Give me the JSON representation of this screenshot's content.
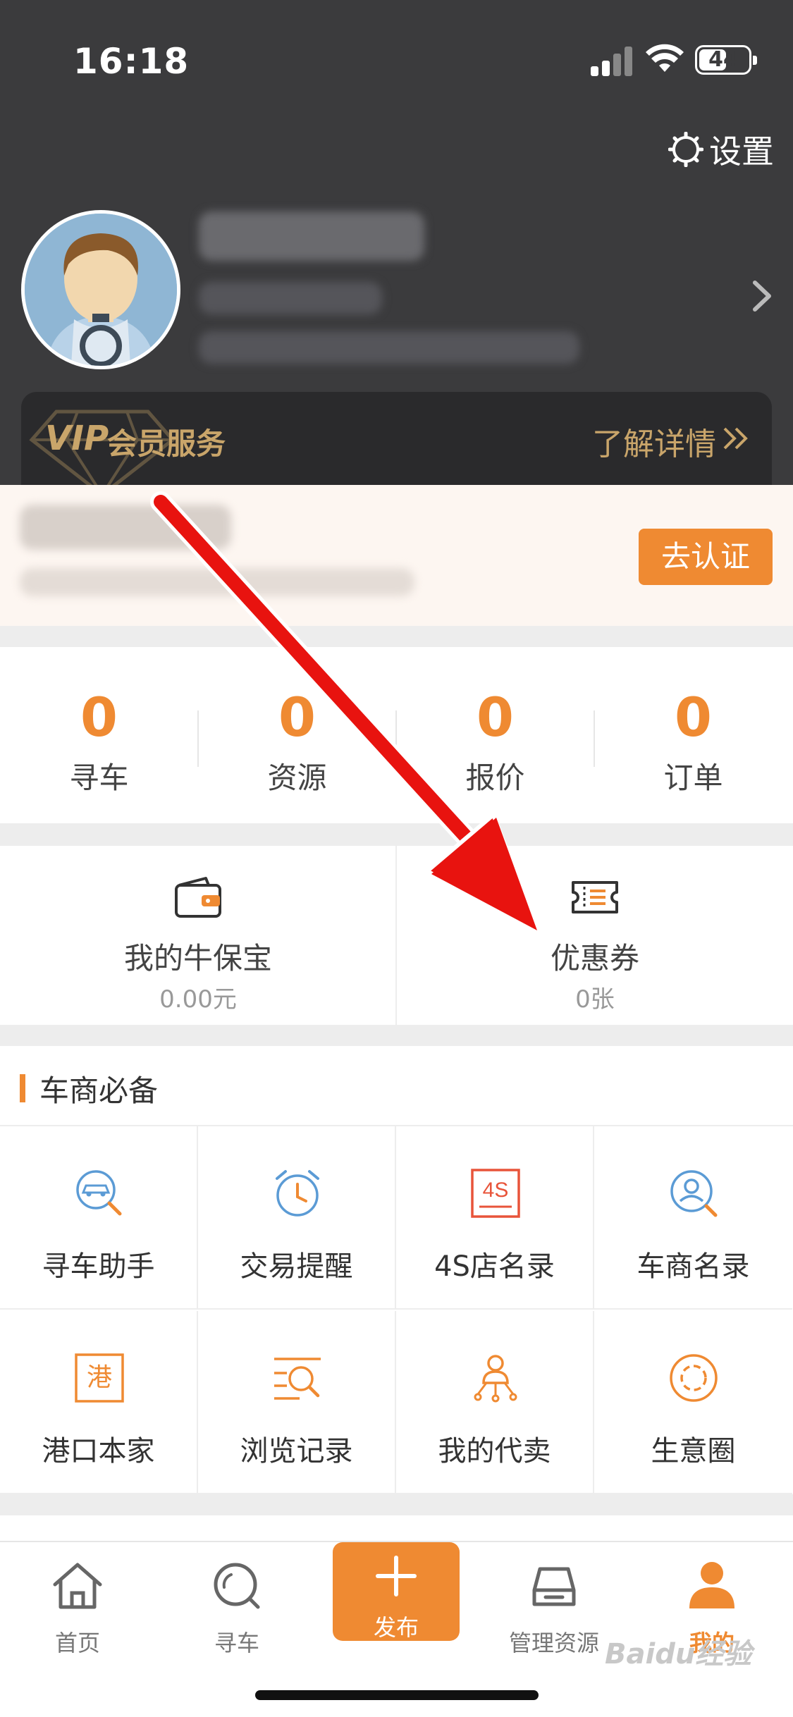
{
  "status_bar": {
    "time": "16:18",
    "battery": "44"
  },
  "header": {
    "settings_label": "设置",
    "vip": {
      "tag": "VIP",
      "title": "会员服务",
      "more": "了解详情"
    }
  },
  "certification": {
    "button": "去认证"
  },
  "stats": [
    {
      "value": "0",
      "label": "寻车"
    },
    {
      "value": "0",
      "label": "资源"
    },
    {
      "value": "0",
      "label": "报价"
    },
    {
      "value": "0",
      "label": "订单"
    }
  ],
  "wallet": {
    "left": {
      "label": "我的牛保宝",
      "sub": "0.00元",
      "icon": "wallet-icon"
    },
    "right": {
      "label": "优惠券",
      "sub": "0张",
      "icon": "coupon-icon"
    }
  },
  "tools": {
    "title": "车商必备",
    "items": [
      {
        "label": "寻车助手",
        "icon": "car-search-icon"
      },
      {
        "label": "交易提醒",
        "icon": "alarm-clock-icon"
      },
      {
        "label": "4S店名录",
        "icon": "4s-badge-icon"
      },
      {
        "label": "车商名录",
        "icon": "dealer-search-icon"
      },
      {
        "label": "港口本家",
        "icon": "port-icon"
      },
      {
        "label": "浏览记录",
        "icon": "history-icon"
      },
      {
        "label": "我的代卖",
        "icon": "agent-sale-icon"
      },
      {
        "label": "生意圈",
        "icon": "circle-icon"
      }
    ]
  },
  "tabbar": {
    "items": [
      {
        "label": "首页",
        "icon": "home-icon"
      },
      {
        "label": "寻车",
        "icon": "search-icon"
      },
      {
        "label": "发布",
        "icon": "plus-icon"
      },
      {
        "label": "管理资源",
        "icon": "car-icon"
      },
      {
        "label": "我的",
        "icon": "user-icon"
      }
    ],
    "active": "我的"
  },
  "colors": {
    "accent": "#ef8a32",
    "header_bg": "#3b3b3d",
    "vip_gold": "#c9a56a",
    "annotation": "#e8130f"
  },
  "watermark": "Baidu经验"
}
